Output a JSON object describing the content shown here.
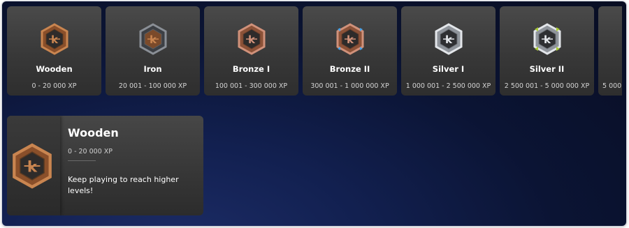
{
  "tiers": [
    {
      "name": "Wooden",
      "xp": "0 - 20 000 XP",
      "badge_icon": "wooden-badge-icon",
      "badge_color": "#b06a3b"
    },
    {
      "name": "Iron",
      "xp": "20 001 - 100 000 XP",
      "badge_icon": "iron-badge-icon",
      "badge_color": "#7a7f86"
    },
    {
      "name": "Bronze I",
      "xp": "100 001 - 300 000 XP",
      "badge_icon": "bronze-badge-icon",
      "badge_color": "#b8755a"
    },
    {
      "name": "Bronze II",
      "xp": "300 001 - 1 000 000 XP",
      "badge_icon": "bronze-ii-badge-icon",
      "badge_color": "#b8755a",
      "gem_color": "#4aa3e8"
    },
    {
      "name": "Silver I",
      "xp": "1 000 001 - 2 500 000 XP",
      "badge_icon": "silver-badge-icon",
      "badge_color": "#c9ccd1"
    },
    {
      "name": "Silver II",
      "xp": "2 500 001 - 5 000 000 XP",
      "badge_icon": "silver-ii-badge-icon",
      "badge_color": "#c9ccd1",
      "gem_color": "#a8c936"
    },
    {
      "name": "",
      "xp": "5 000",
      "badge_icon": ""
    }
  ],
  "detail": {
    "title": "Wooden",
    "xp": "0 - 20 000 XP",
    "message": "Keep playing to reach higher levels!",
    "badge_icon": "wooden-badge-icon"
  },
  "colors": {
    "background": "#0b1434",
    "card": "#3a3a3a",
    "wood": "#b06a3b"
  }
}
